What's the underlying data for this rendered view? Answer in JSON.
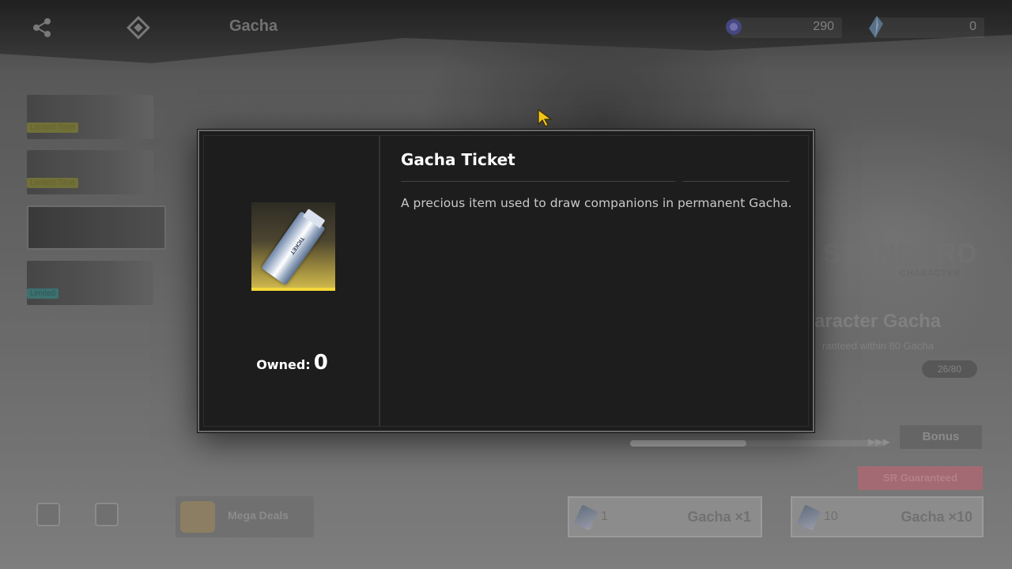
{
  "header": {
    "title": "Gacha",
    "icons": [
      "share-icon",
      "diamond-nav-icon"
    ],
    "currencies": [
      {
        "icon": "orb-currency-icon",
        "value": "290",
        "color": "#5b5bd6"
      },
      {
        "icon": "crystal-currency-icon",
        "value": "0",
        "color": "#6f9fd6"
      }
    ]
  },
  "banners": [
    {
      "tag": "Limited Time",
      "selected": false
    },
    {
      "tag": "Limited Time",
      "selected": false
    },
    {
      "tag": "",
      "selected": true
    },
    {
      "tag": "Limited",
      "selected": false
    }
  ],
  "banner_info": {
    "standard_title": "STANDARD",
    "standard_sub": "CHARACTER",
    "gacha_name": "aracter Gacha",
    "note": "ranteed within 80 Gacha",
    "pity": "26/80",
    "progress": 0.46,
    "bonus_label": "Bonus",
    "guaranteed_label": "SR Guaranteed"
  },
  "bottom_bar": {
    "mega_deals": "Mega Deals",
    "pull_one": {
      "cost": "1",
      "label": "Gacha ×1"
    },
    "pull_ten": {
      "cost": "10",
      "label": "Gacha ×10"
    }
  },
  "modal": {
    "item_name": "Gacha Ticket",
    "item_icon": "gacha-ticket-icon",
    "ticket_text": "TICKET",
    "description": "A precious item used to draw companions in permanent Gacha.",
    "owned_label": "Owned:",
    "owned_value": "0",
    "accent": "#f4d838"
  }
}
